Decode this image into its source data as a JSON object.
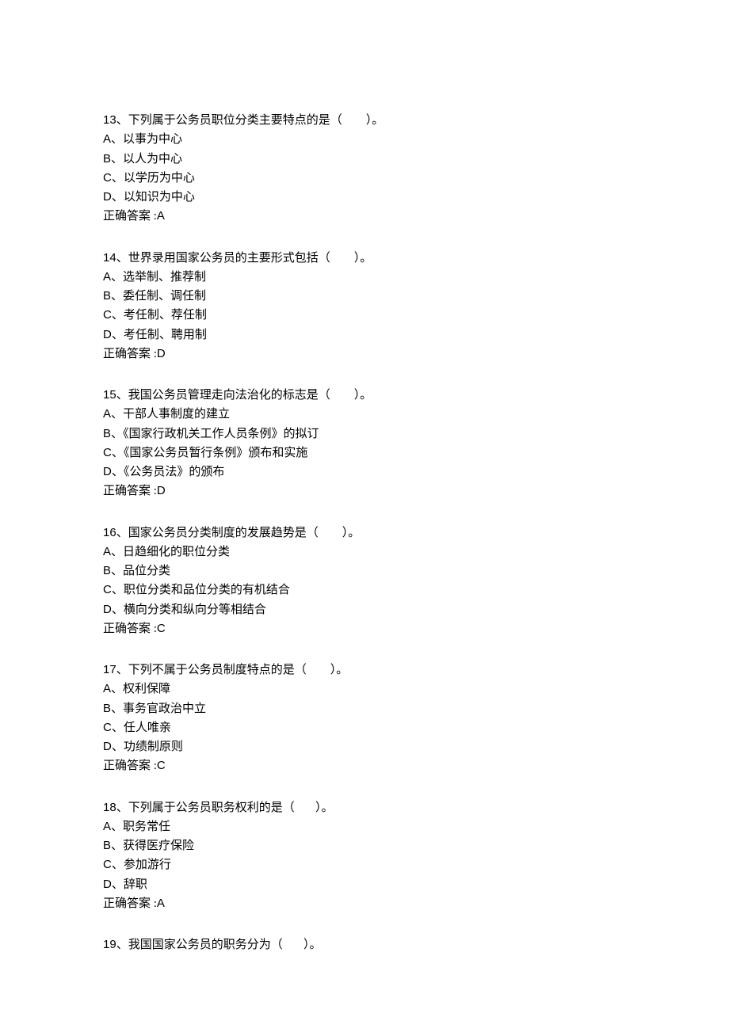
{
  "labels": {
    "answer_prefix": "正确答案 :",
    "blank_paren": "（        ）。",
    "blank_paren_short": "（       ）。"
  },
  "questions": [
    {
      "number": "13",
      "stem": "、下列属于公务员职位分类主要特点的是",
      "options": [
        {
          "label": "A",
          "text": "、以事为中心"
        },
        {
          "label": "B",
          "text": "、以人为中心"
        },
        {
          "label": "C",
          "text": "、以学历为中心"
        },
        {
          "label": "D",
          "text": "、以知识为中心"
        }
      ],
      "answer": "A"
    },
    {
      "number": "14",
      "stem": "、世界录用国家公务员的主要形式包括",
      "options": [
        {
          "label": "A",
          "text": "、选举制、推荐制"
        },
        {
          "label": "B",
          "text": "、委任制、调任制"
        },
        {
          "label": "C",
          "text": "、考任制、荐任制"
        },
        {
          "label": "D",
          "text": "、考任制、聘用制"
        }
      ],
      "answer": "D"
    },
    {
      "number": "15",
      "stem": "、我国公务员管理走向法治化的标志是",
      "options": [
        {
          "label": "A",
          "text": "、干部人事制度的建立"
        },
        {
          "label": "B",
          "text": "、《国家行政机关工作人员条例》的拟订"
        },
        {
          "label": "C",
          "text": "、《国家公务员暂行条例》颁布和实施"
        },
        {
          "label": "D",
          "text": "、《公务员法》的颁布"
        }
      ],
      "answer": "D"
    },
    {
      "number": "16",
      "stem": "、国家公务员分类制度的发展趋势是",
      "options": [
        {
          "label": "A",
          "text": "、日趋细化的职位分类"
        },
        {
          "label": "B",
          "text": "、品位分类"
        },
        {
          "label": "C",
          "text": "、职位分类和品位分类的有机结合"
        },
        {
          "label": "D",
          "text": "、横向分类和纵向分等相结合"
        }
      ],
      "answer": "C"
    },
    {
      "number": "17",
      "stem": "、下列不属于公务员制度特点的是",
      "options": [
        {
          "label": "A",
          "text": "、权利保障"
        },
        {
          "label": "B",
          "text": "、事务官政治中立"
        },
        {
          "label": "C",
          "text": "、任人唯亲"
        },
        {
          "label": "D",
          "text": "、功绩制原则"
        }
      ],
      "answer": "C"
    },
    {
      "number": "18",
      "stem": "、下列属于公务员职务权利的是",
      "options": [
        {
          "label": "A",
          "text": "、职务常任"
        },
        {
          "label": "B",
          "text": "、获得医疗保险"
        },
        {
          "label": "C",
          "text": "、参加游行"
        },
        {
          "label": "D",
          "text": "、辞职"
        }
      ],
      "answer": "A"
    },
    {
      "number": "19",
      "stem": "、我国国家公务员的职务分为",
      "options": [],
      "answer": ""
    }
  ]
}
